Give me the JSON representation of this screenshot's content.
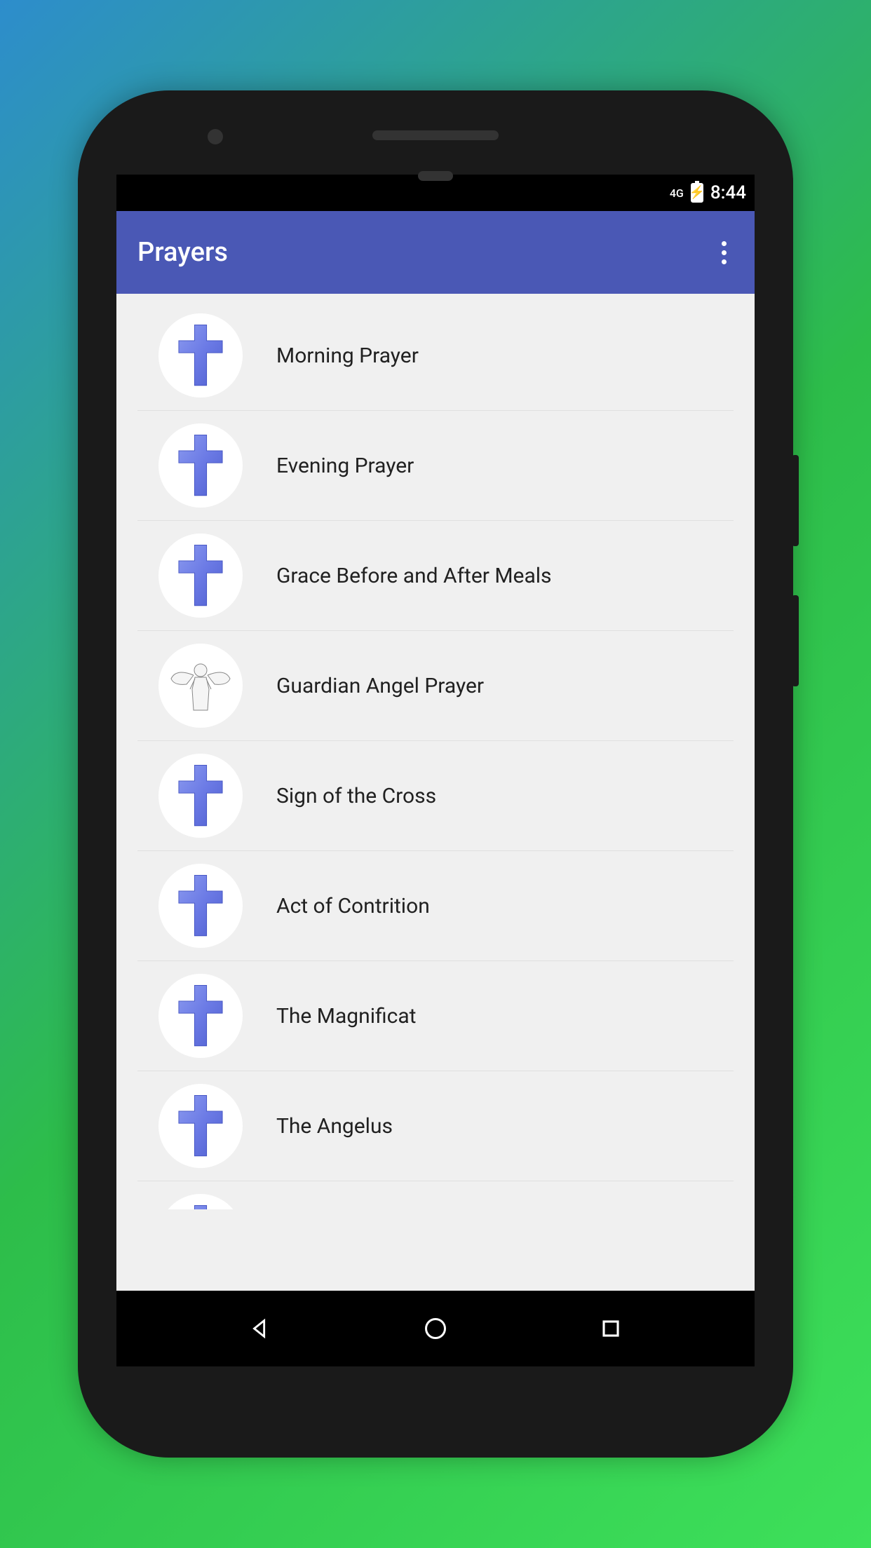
{
  "status": {
    "network": "4G",
    "time": "8:44"
  },
  "appbar": {
    "title": "Prayers"
  },
  "prayers": [
    {
      "label": "Morning Prayer",
      "icon": "cross"
    },
    {
      "label": "Evening Prayer",
      "icon": "cross"
    },
    {
      "label": "Grace Before and After Meals",
      "icon": "cross"
    },
    {
      "label": "Guardian Angel Prayer",
      "icon": "angel"
    },
    {
      "label": "Sign of the Cross",
      "icon": "cross"
    },
    {
      "label": "Act of Contrition",
      "icon": "cross"
    },
    {
      "label": "The Magnificat",
      "icon": "cross"
    },
    {
      "label": "The Angelus",
      "icon": "cross"
    }
  ],
  "colors": {
    "appbar": "#4a58b5",
    "cross": "#6b7ae5"
  }
}
